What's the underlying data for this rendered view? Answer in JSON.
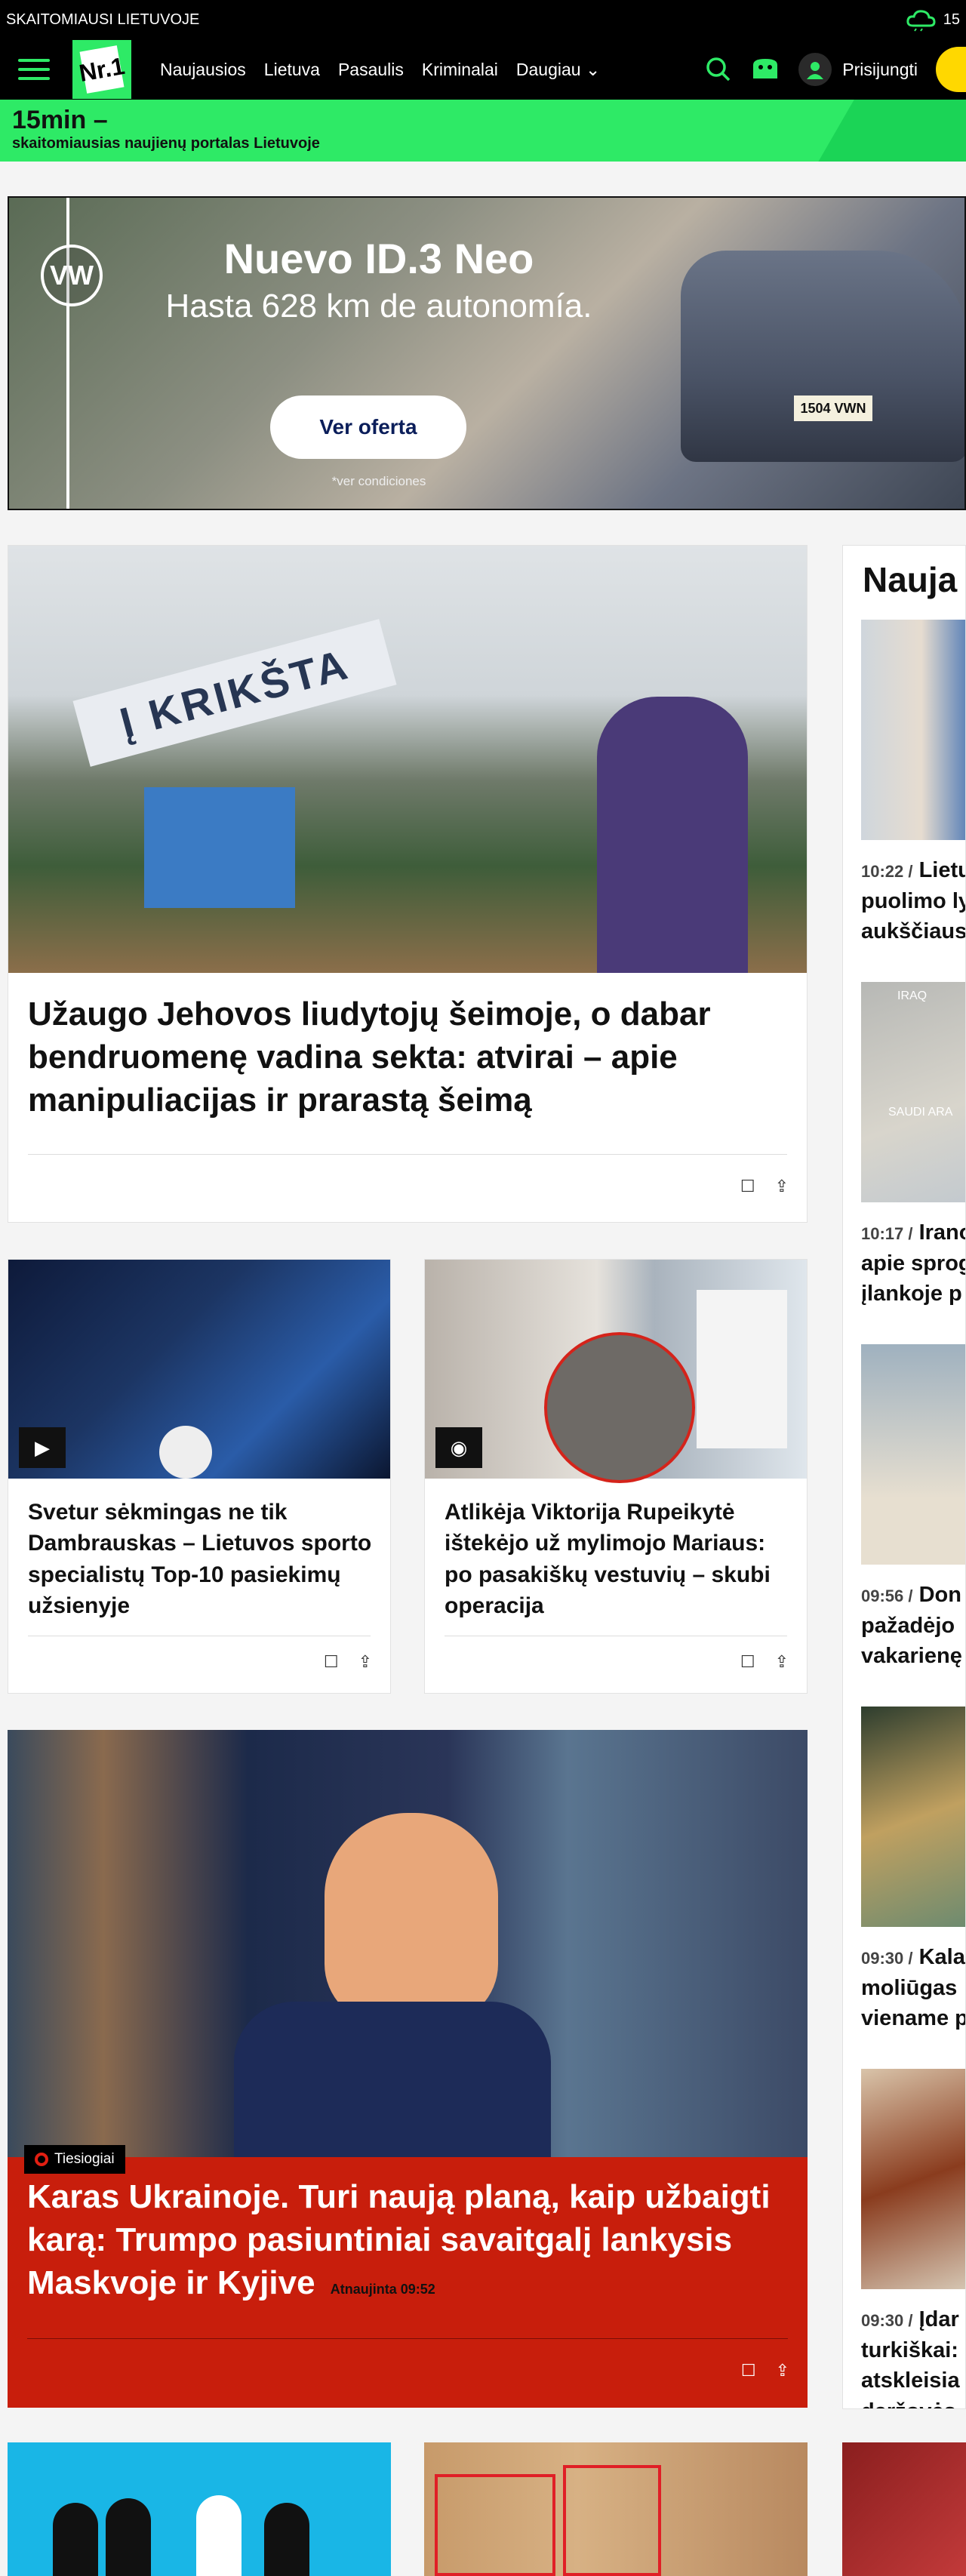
{
  "topbar": {
    "tagline": "SKAITOMIAUSI LIETUVOJE",
    "weather_temp": "15"
  },
  "nav": {
    "logo_text": "Nr.1",
    "items": [
      "Naujausios",
      "Lietuva",
      "Pasaulis",
      "Kriminalai",
      "Daugiau"
    ],
    "login_label": "Prisijungti"
  },
  "banner": {
    "line1": "15min –",
    "line2": "skaitomiausias naujienų portalas Lietuvoje"
  },
  "ad": {
    "title": "Nuevo ID.3 Neo",
    "subtitle": "Hasta 628 km de autonomía.",
    "cta": "Ver oferta",
    "note": "*ver condiciones",
    "brand": "VW",
    "plate": "1504 VWN"
  },
  "articles": {
    "main": {
      "title": "Užaugo Jehovos liudytojų šeimoje, o dabar bendruomenę vadina sekta: atvirai – apie manipuliacijas ir prarastą šeimą",
      "sign_text": "Į KRIKŠTA"
    },
    "left_small": {
      "title": "Svetur sėkmingas ne tik Dambrauskas – Lietuvos sporto specialistų Top-10 pasiekimų užsienyje"
    },
    "right_small": {
      "title": "Atlikėja Viktorija Rupeikytė ištekėjo už mylimojo Mariaus: po pasakiškų vestuvių – skubi operacija"
    },
    "live": {
      "badge": "Tiesiogiai",
      "title": "Karas Ukrainoje. Turi naują planą, kaip užbaigti karą: Trumpo pasiuntiniai savaitgalį lankysis Maskvoje ir Kyjive",
      "updated": "Atnaujinta 09:52"
    }
  },
  "sidebar": {
    "title": "Nauja",
    "items": [
      {
        "time": "10:22 /",
        "lines": [
          "Lietu",
          "puolimo ly",
          "aukščiaus"
        ]
      },
      {
        "time": "10:17 /",
        "lines": [
          "Irano",
          "apie sprog",
          "įlankoje p"
        ],
        "map_labels": [
          "IRAQ",
          "SAUDI ARA"
        ]
      },
      {
        "time": "09:56 /",
        "lines": [
          "Don",
          "pažadėjo",
          "vakarienę"
        ]
      },
      {
        "time": "09:30 /",
        "lines": [
          "Kala",
          "moliūgas",
          "viename p"
        ]
      },
      {
        "time": "09:30 /",
        "lines": [
          "Įdar",
          "turkiškai:",
          "atskleisia",
          "daržovės"
        ]
      }
    ]
  },
  "colors": {
    "accent": "#2eea66",
    "live": "#c81e0c",
    "black": "#000000"
  }
}
